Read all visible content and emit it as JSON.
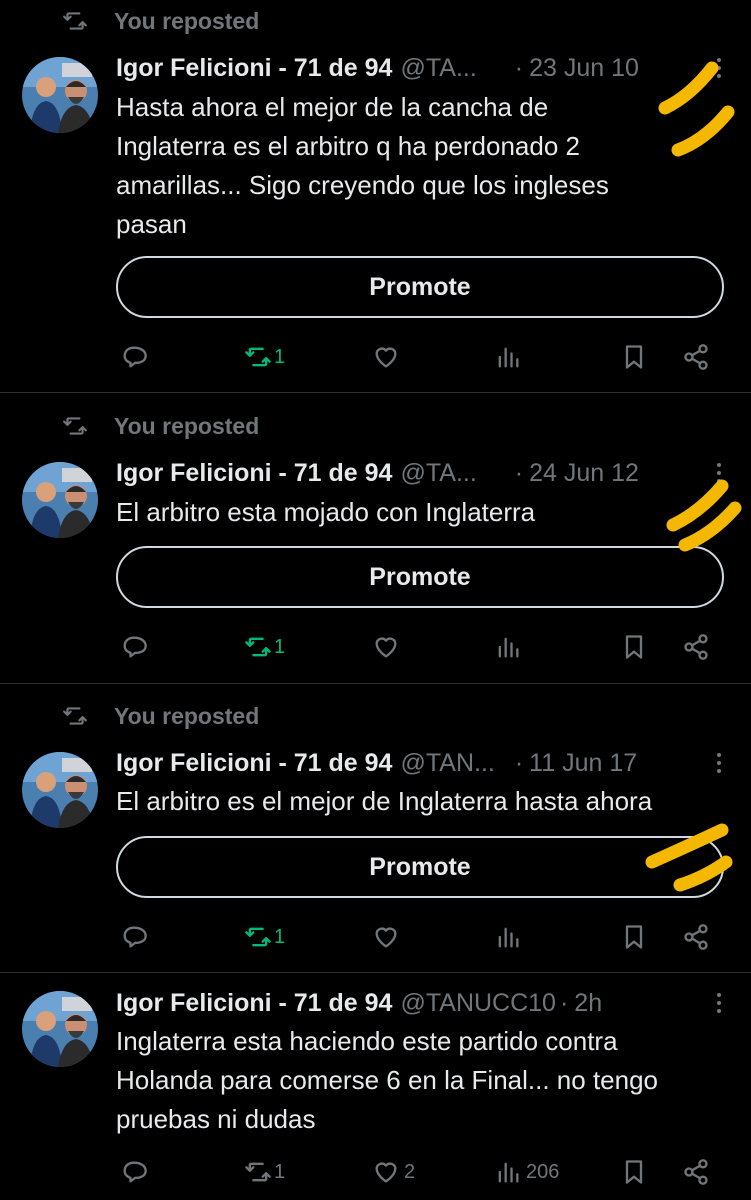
{
  "tweets": [
    {
      "repost_label": "You reposted",
      "name": "Igor Felicioni - 71 de 94",
      "handle": "@TA...",
      "separator": "·",
      "time": "23 Jun 10",
      "text_lines": [
        "Hasta ahora el mejor de la cancha de",
        "Inglaterra es el arbitro q ha perdonado 2",
        "amarillas... Sigo creyendo que los ingleses",
        "pasan"
      ],
      "promote": "Promote",
      "retweet_count": "1"
    },
    {
      "repost_label": "You reposted",
      "name": "Igor Felicioni - 71 de 94",
      "handle": "@TA...",
      "separator": "·",
      "time": "24 Jun 12",
      "text_lines": [
        "El arbitro esta mojado con Inglaterra"
      ],
      "promote": "Promote",
      "retweet_count": "1"
    },
    {
      "repost_label": "You reposted",
      "name": "Igor Felicioni - 71 de 94",
      "handle": "@TAN...",
      "separator": "·",
      "time": "11 Jun 17",
      "text_lines": [
        "El arbitro es el mejor de Inglaterra hasta ahora"
      ],
      "promote": "Promote",
      "retweet_count": "1"
    },
    {
      "name": "Igor Felicioni - 71 de 94",
      "handle": "@TANUCC10",
      "separator": "·",
      "time": "2h",
      "text_lines": [
        "Inglaterra esta haciendo este partido contra",
        "Holanda para comerse 6 en la Final... no tengo",
        "pruebas ni dudas"
      ],
      "retweet_count": "1",
      "like_count": "2",
      "views_count": "206"
    }
  ],
  "colors": {
    "background": "#000000",
    "text": "#e7e9ea",
    "muted": "#71767b",
    "repost_green": "#00ba7c",
    "highlight_marker": "#f5b800"
  }
}
